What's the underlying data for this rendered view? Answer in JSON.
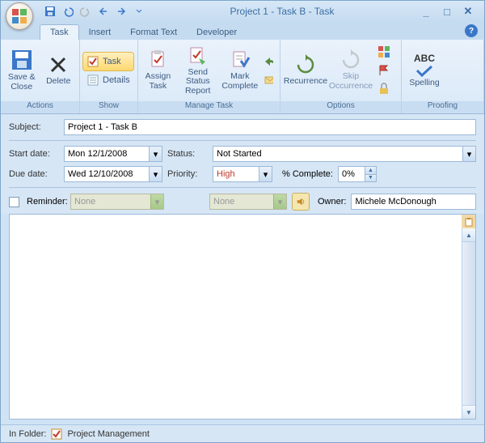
{
  "title": "Project 1 - Task B  -  Task",
  "qat": {
    "save": "save",
    "undo": "undo",
    "redo": "redo",
    "prev": "prev",
    "next": "next"
  },
  "tabs": [
    "Task",
    "Insert",
    "Format Text",
    "Developer"
  ],
  "ribbon": {
    "actions": {
      "label": "Actions",
      "save_close": "Save &\nClose",
      "delete": "Delete"
    },
    "show": {
      "label": "Show",
      "task": "Task",
      "details": "Details"
    },
    "manage": {
      "label": "Manage Task",
      "assign": "Assign\nTask",
      "send": "Send Status\nReport",
      "mark": "Mark\nComplete"
    },
    "options": {
      "label": "Options",
      "recurrence": "Recurrence",
      "skip": "Skip\nOccurrence"
    },
    "proofing": {
      "label": "Proofing",
      "spelling": "Spelling"
    }
  },
  "form": {
    "subject_label": "Subject:",
    "subject_value": "Project 1 - Task B",
    "start_label": "Start date:",
    "start_value": "Mon 12/1/2008",
    "due_label": "Due date:",
    "due_value": "Wed 12/10/2008",
    "status_label": "Status:",
    "status_value": "Not Started",
    "priority_label": "Priority:",
    "priority_value": "High",
    "pct_label": "% Complete:",
    "pct_value": "0%",
    "reminder_label": "Reminder:",
    "reminder_date": "None",
    "reminder_time": "None",
    "owner_label": "Owner:",
    "owner_value": "Michele McDonough"
  },
  "status": {
    "folder_label": "In Folder:",
    "folder_value": "Project Management"
  },
  "colors": {
    "accent": "#3a77c9",
    "high": "#c0392b"
  }
}
